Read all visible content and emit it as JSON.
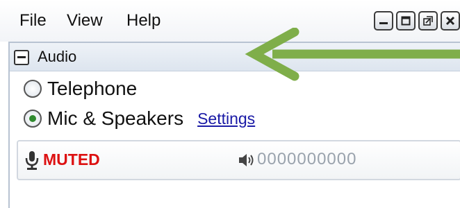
{
  "menubar": {
    "items": [
      {
        "label": "File"
      },
      {
        "label": "View"
      },
      {
        "label": "Help"
      }
    ],
    "window_buttons": [
      "minimize-icon",
      "maximize-icon",
      "restore-icon",
      "close-icon"
    ]
  },
  "audio_panel": {
    "title": "Audio",
    "options": [
      {
        "label": "Telephone",
        "selected": false
      },
      {
        "label": "Mic & Speakers",
        "selected": true
      }
    ],
    "settings_link": "Settings",
    "status": {
      "mic_state": "MUTED",
      "level_meter": "0000000000"
    }
  },
  "colors": {
    "muted": "#dd1111",
    "selected_radio": "#2f8a2f",
    "link": "#1a1aa6",
    "annotation_arrow": "#7fae4a"
  }
}
